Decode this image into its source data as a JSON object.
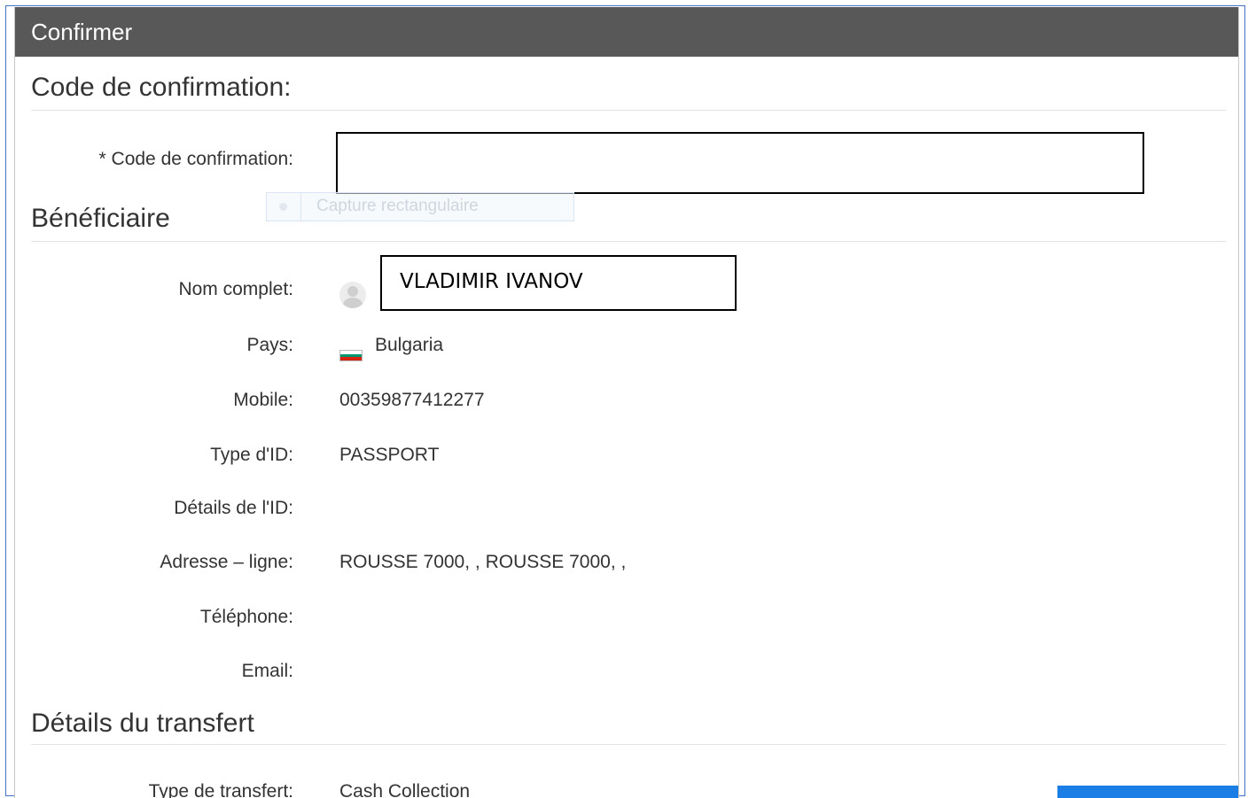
{
  "dialog": {
    "title": "Confirmer"
  },
  "confirmation": {
    "section_title": "Code de confirmation:",
    "field_label": "* Code de confirmation:",
    "field_value": ""
  },
  "tooltip": {
    "label": "Capture rectangulaire"
  },
  "beneficiary": {
    "section_title": "Bénéficiaire",
    "rows": [
      {
        "label": "Nom complet:",
        "value": "VLADIMIR IVANOV"
      },
      {
        "label": "Pays:",
        "value": "Bulgaria"
      },
      {
        "label": "Mobile:",
        "value": "00359877412277"
      },
      {
        "label": "Type d'ID:",
        "value": "PASSPORT"
      },
      {
        "label": "Détails de l'ID:",
        "value": ""
      },
      {
        "label": "Adresse – ligne:",
        "value": "ROUSSE 7000, , ROUSSE 7000, ,"
      },
      {
        "label": "Téléphone:",
        "value": ""
      },
      {
        "label": "Email:",
        "value": ""
      }
    ]
  },
  "transfer": {
    "section_title": "Détails du transfert",
    "rows": [
      {
        "label": "Type de transfert:",
        "value": "Cash Collection"
      }
    ]
  },
  "icons": {
    "avatar": "user-avatar-icon",
    "flag": "bulgaria-flag-icon"
  },
  "colors": {
    "header_bg": "#585858",
    "frame_border": "#4472c4",
    "accent_button": "#1a7ee6"
  }
}
